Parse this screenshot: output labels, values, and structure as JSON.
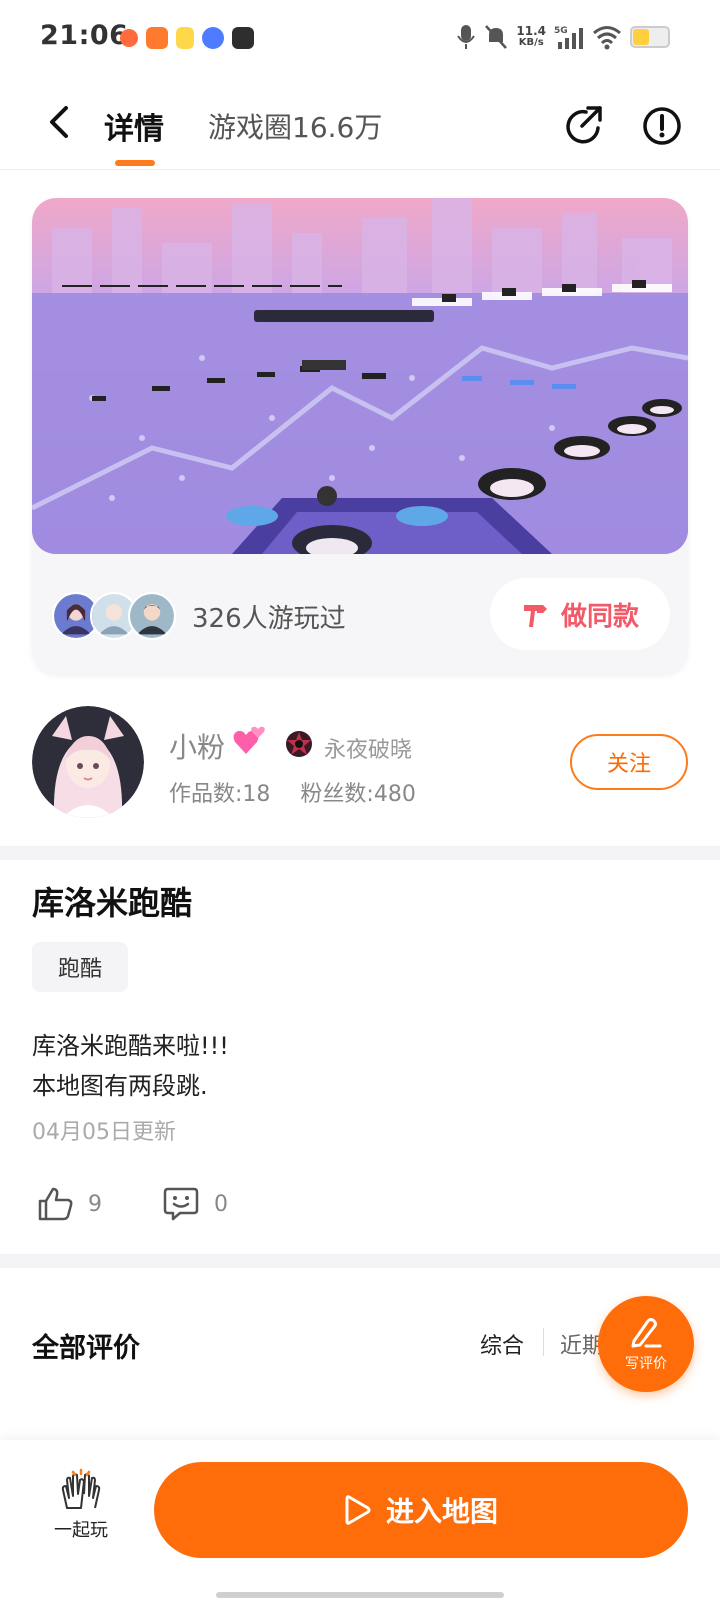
{
  "status_bar": {
    "time": "21:06",
    "net_speed_value": "11.4",
    "net_speed_unit": "KB/s",
    "network": "5G"
  },
  "header": {
    "tab_detail": "详情",
    "tab_circle": "游戏圈16.6万",
    "active_tab": "详情",
    "accent_color": "#ff7a1a"
  },
  "cover": {
    "played_count_text": "326人游玩过",
    "make_same_label": "做同款",
    "make_same_color": "#f25a6a"
  },
  "author": {
    "name": "小粉",
    "title": "永夜破晓",
    "works": "作品数:18",
    "fans": "粉丝数:480",
    "follow_label": "关注"
  },
  "game": {
    "title": "库洛米跑酷",
    "tag": "跑酷",
    "desc_line1": "库洛米跑酷来啦!!!",
    "desc_line2": "本地图有两段跳.",
    "updated": "04月05日更新",
    "likes": "9",
    "comments": "0"
  },
  "reviews": {
    "title": "全部评价",
    "sort_all": "综合",
    "sort_recent": "近期",
    "write_label": "写评价"
  },
  "bottom": {
    "play_together_label": "一起玩",
    "enter_map_label": "进入地图",
    "button_color": "#ff6d0a"
  }
}
